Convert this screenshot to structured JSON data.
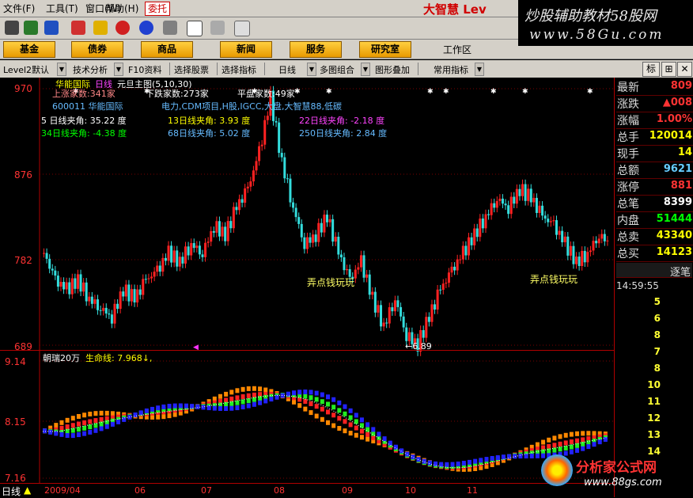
{
  "menu": {
    "items": [
      "文件(F)",
      "工具(T)",
      "窗口(W)",
      "帮助(H)"
    ],
    "weituo": "委托",
    "brand": "大智慧 Lev"
  },
  "watermark": {
    "line1": "炒股辅助教材58股网",
    "line2": "www.58Gu.com"
  },
  "nav": {
    "buttons": [
      "基金",
      "债券",
      "商品",
      "新闻",
      "服务",
      "研究室"
    ],
    "workarea": "工作区"
  },
  "func": {
    "items": [
      "Level2默认",
      "技术分析",
      "F10资料",
      "选择股票",
      "选择指标",
      "日线",
      "多图组合",
      "图形叠加",
      "常用指标"
    ]
  },
  "righttabs": {
    "a": "标"
  },
  "chart": {
    "title": "华能国际",
    "period_tag": "日线",
    "main_label": "元旦主图(5,10,30)",
    "up_count": "上涨家数:341家",
    "down_count": "下跌家数:273家",
    "flat_count": "平盘家数:49家",
    "stock_line": "600011  华能国际",
    "concepts": "电力,CDM项目,H股,IGCC,大盘,大智慧88,低碳",
    "angles": [
      {
        "text": "5 日线夹角: 35.22 度",
        "color": "#ffffff"
      },
      {
        "text": "13日线夹角: 3.93 度",
        "color": "#ffff00"
      },
      {
        "text": "22日线夹角: -2.18 度",
        "color": "#ff44ff"
      },
      {
        "text": "34日线夹角: -4.38 度",
        "color": "#00ff00"
      },
      {
        "text": "68日线夹角: 5.02 度",
        "color": "#66bbff"
      },
      {
        "text": "250日线夹角: 2.84 度",
        "color": "#66bbff"
      }
    ],
    "ann1": "弄点钱玩玩",
    "ann2": "弄点钱玩玩",
    "low_label": "←6.89",
    "y_main": [
      "970",
      "876",
      "782",
      "689"
    ],
    "y_sub": [
      "9.14",
      "8.15",
      "7.16"
    ],
    "sub_title": "朝瑞20万",
    "lifeline": "生命线: 7.968↓,",
    "x_labels": [
      "2009/04",
      "06",
      "07",
      "08",
      "09",
      "10",
      "11"
    ],
    "period_footer": "日线",
    "brand88_name": "分析家公式网",
    "brand88_url": "www.88gs.com"
  },
  "chart_data": {
    "type": "candlestick",
    "title": "华能国际",
    "ylim": [
      6.89,
      9.7
    ],
    "x_labels": [
      "2009/04",
      "06",
      "07",
      "08",
      "09",
      "10",
      "11"
    ],
    "candles_close_approx": [
      7.9,
      7.6,
      7.5,
      7.6,
      7.4,
      7.3,
      7.2,
      7.5,
      7.4,
      7.6,
      7.7,
      7.9,
      7.8,
      8.0,
      7.9,
      8.2,
      8.1,
      8.4,
      8.6,
      9.0,
      9.6,
      8.9,
      8.4,
      8.0,
      8.1,
      8.3,
      7.9,
      7.6,
      7.8,
      7.4,
      7.1,
      7.4,
      7.0,
      6.9,
      7.2,
      7.5,
      7.7,
      7.9,
      8.1,
      8.3,
      8.5,
      8.4,
      8.6,
      8.5,
      8.3,
      8.2,
      8.0,
      7.8,
      7.9,
      8.1,
      8.0
    ]
  },
  "quote": {
    "rows": [
      {
        "label": "最新",
        "value": "809",
        "color": "#ff3333"
      },
      {
        "label": "涨跌",
        "value": "▲008",
        "color": "#ff3333"
      },
      {
        "label": "涨幅",
        "value": "1.00%",
        "color": "#ff3333"
      },
      {
        "label": "总手",
        "value": "120014",
        "color": "#ffff00"
      },
      {
        "label": "现手",
        "value": "14",
        "color": "#ffff00"
      },
      {
        "label": "总额",
        "value": "9621",
        "color": "#66ccff"
      },
      {
        "label": "涨停",
        "value": "881",
        "color": "#ff3333"
      },
      {
        "label": "总笔",
        "value": "8399",
        "color": "#ffffff"
      },
      {
        "label": "内盘",
        "value": "51444",
        "color": "#00ff00"
      },
      {
        "label": "总卖",
        "value": "43340",
        "color": "#ffff00"
      },
      {
        "label": "总买",
        "value": "14123",
        "color": "#ffff00"
      }
    ],
    "tick_header": "逐笔",
    "time": "14:59:55",
    "ticks": [
      "5",
      "6",
      "8",
      "7",
      "8",
      "10",
      "11",
      "12",
      "13",
      "14"
    ]
  },
  "colors": {
    "up": "#ff2222",
    "down": "#33dddd",
    "orange": "#ff8800",
    "green": "#22ee22",
    "blue": "#2222ff"
  }
}
